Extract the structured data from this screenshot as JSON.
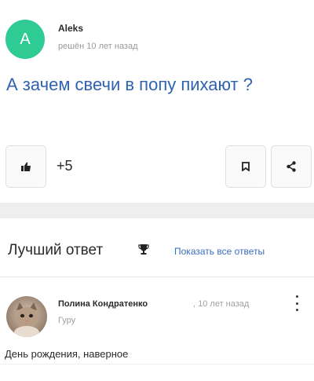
{
  "question": {
    "avatar_letter": "A",
    "avatar_color": "#2fcb95",
    "author": "Aleks",
    "meta": "решён 10 лет назад",
    "text": "А зачем свечи в попу пихают ?",
    "likes": "+5",
    "icons": [
      "thumbs-up-icon",
      "bookmark-icon",
      "share-icon"
    ]
  },
  "best": {
    "title": "Лучший ответ",
    "show_all": "Показать все ответы",
    "icon": "trophy-icon"
  },
  "answer": {
    "author": "Полина Кондратенко",
    "time": ", 10 лет назад",
    "rank": "Гуру",
    "text": "День рождения, наверное",
    "menu_icon": "kebab-menu-icon"
  },
  "colors": {
    "link": "#3b6dc0",
    "question_text": "#2f62b0",
    "muted": "#9a9a9a"
  }
}
